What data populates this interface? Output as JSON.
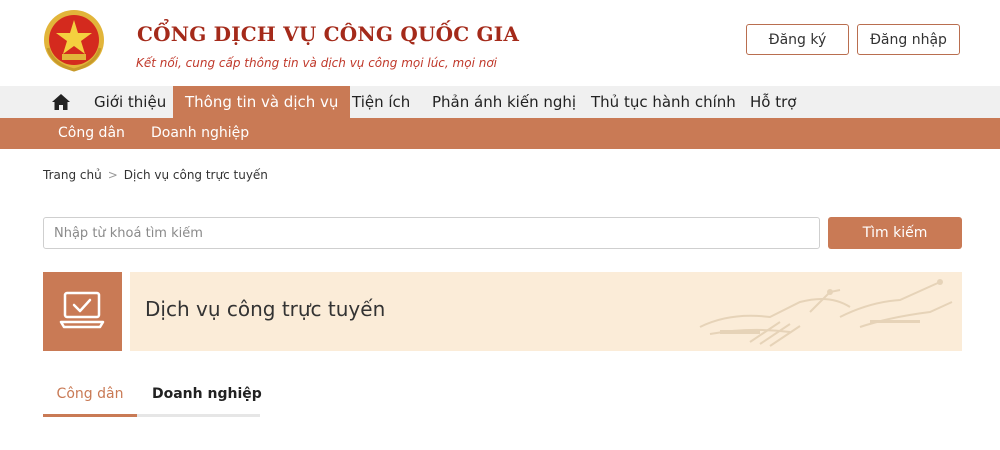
{
  "header": {
    "site_title": "CỔNG DỊCH VỤ CÔNG QUỐC GIA",
    "slogan": "Kết nối, cung cấp thông tin và dịch vụ công mọi lúc, mọi nơi",
    "register_label": "Đăng ký",
    "login_label": "Đăng nhập",
    "emblem_icon": "national-emblem-icon"
  },
  "main_nav": {
    "home_icon": "home-icon",
    "items": [
      {
        "label": "Giới thiệu"
      },
      {
        "label": "Thông tin và dịch vụ",
        "active": true
      },
      {
        "label": "Tiện ích"
      },
      {
        "label": "Phản ánh kiến nghị"
      },
      {
        "label": "Thủ tục hành chính"
      },
      {
        "label": "Hỗ trợ"
      }
    ]
  },
  "sub_nav": {
    "items": [
      {
        "label": "Công dân"
      },
      {
        "label": "Doanh nghiệp"
      }
    ]
  },
  "breadcrumb": {
    "home": "Trang chủ",
    "separator": ">",
    "current": "Dịch vụ công trực tuyến"
  },
  "search": {
    "placeholder": "Nhập từ khoá tìm kiếm",
    "value": "",
    "button_label": "Tìm kiếm"
  },
  "banner": {
    "title": "Dịch vụ công trực tuyến",
    "icon": "laptop-check-icon"
  },
  "tabs": {
    "items": [
      {
        "label": "Công dân",
        "active": true
      },
      {
        "label": "Doanh nghiệp"
      }
    ]
  },
  "colors": {
    "accent": "#c97a55",
    "title_red": "#a42a1a",
    "banner_bg": "#fbecd8",
    "nav_bg": "#f0f0f0"
  }
}
